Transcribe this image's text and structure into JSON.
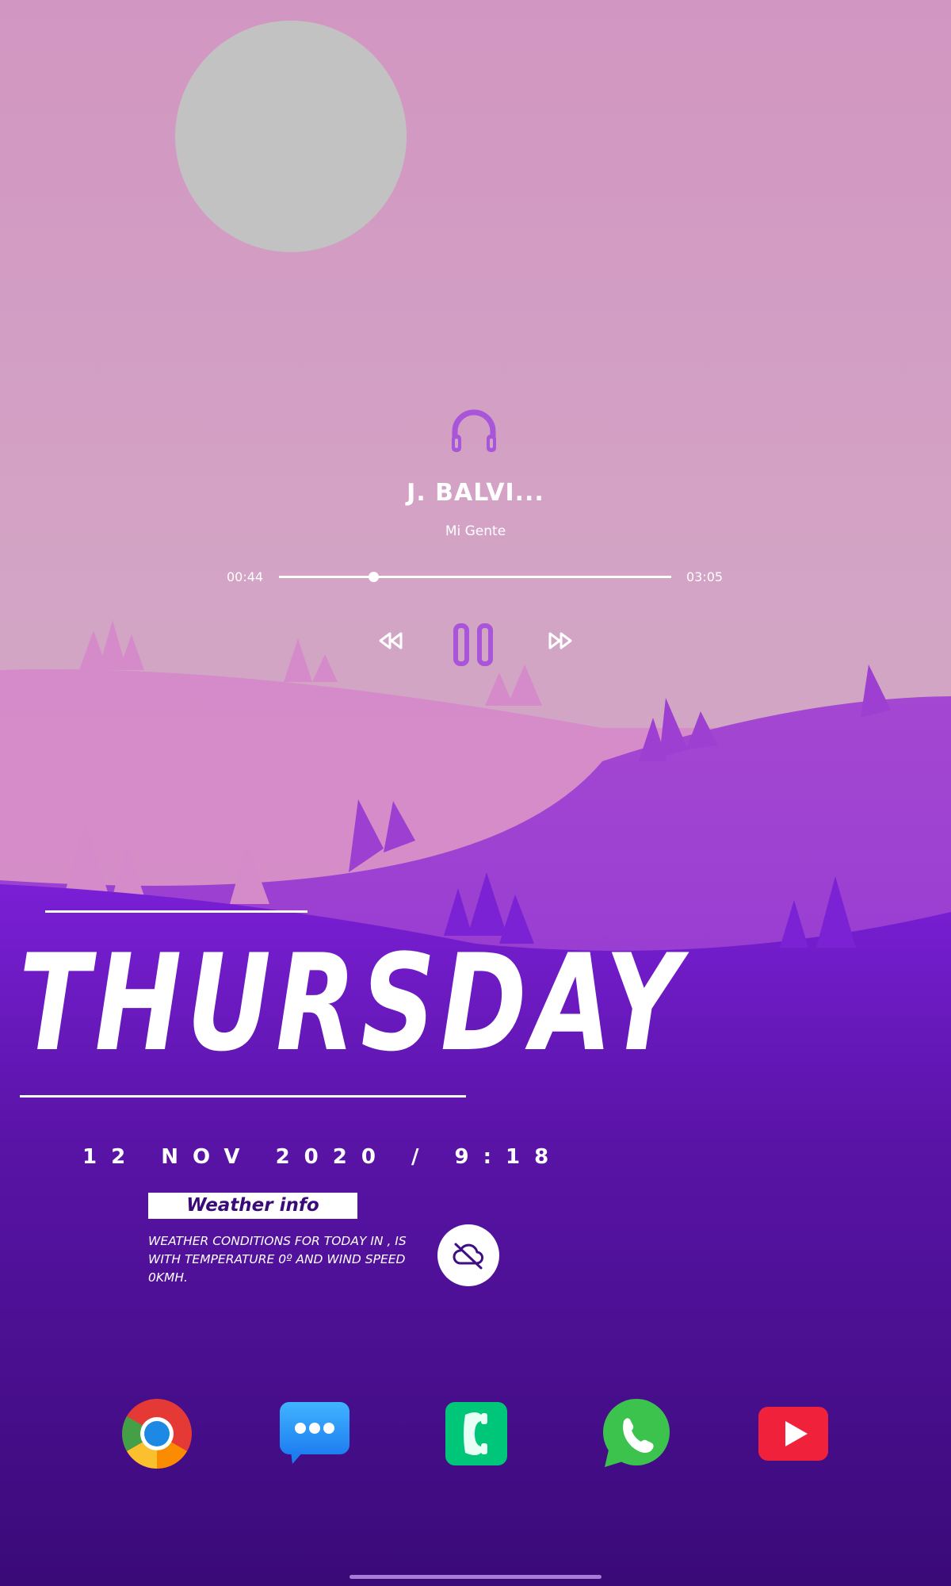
{
  "colors": {
    "accent": "#a855d9",
    "sky_top": "#d296c2",
    "hill_far": "#d38bc8",
    "hill_mid": "#9b3ad4",
    "hill_near": "#7a1fd6",
    "deep_purple": "#3f0d86",
    "text": "#ffffff"
  },
  "player": {
    "icon": "headphones-icon",
    "title": "J. BALVI...",
    "subtitle": "Mi Gente",
    "elapsed": "00:44",
    "total": "03:05",
    "progress": 0.24,
    "controls": [
      "rewind-icon",
      "pause-icon",
      "fast-forward-icon"
    ]
  },
  "clock": {
    "day": "THURSDAY",
    "date_time": "12 NOV 2020 / 9:18"
  },
  "weather": {
    "title": "Weather info",
    "text": "WEATHER CONDITIONS FOR TODAY IN ,  IS WITH TEMPERATURE 0º AND WIND SPEED 0KMH.",
    "icon": "cloud-off-icon"
  },
  "dock": {
    "apps": [
      "chrome-icon",
      "messages-icon",
      "phone-icon",
      "whatsapp-icon",
      "youtube-icon"
    ]
  }
}
